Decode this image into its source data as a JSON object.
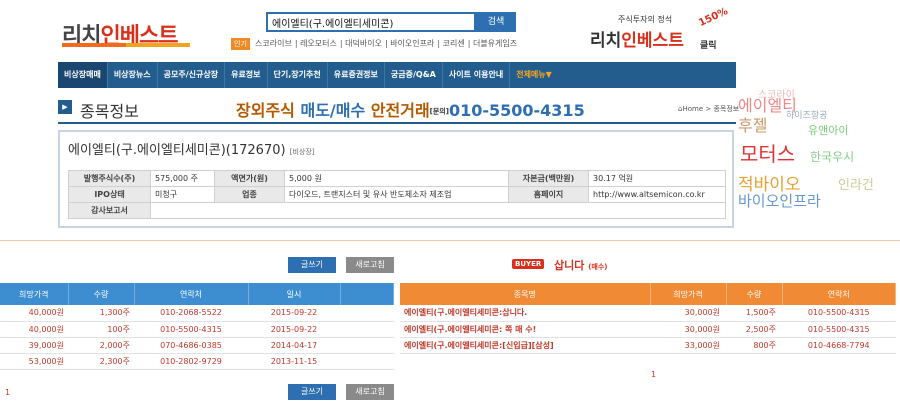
{
  "header": {
    "logo_a": "리치",
    "logo_b": "인베스트",
    "search_value": "에이엘티(구.에이엘티세미콘)",
    "search_button": "검색",
    "hot_badge": "인기",
    "hot_links": [
      "스코라이브",
      "레오모터스",
      "대덕바이오",
      "바이오인프라",
      "코리센",
      "더블유게임즈"
    ],
    "ad_line1": "주식투자의 정석",
    "ad_logo_a": "리치",
    "ad_logo_b": "인베스트",
    "ad_pct": "150%",
    "ad_click": "클릭"
  },
  "nav": {
    "items": [
      "비상장매매",
      "비상장뉴스",
      "공모주/신규상장",
      "유료정보",
      "단기,장기추천",
      "유료증권정보",
      "궁금증/Q&A",
      "사이트 이용안내"
    ],
    "all_menu": "전체메뉴▼"
  },
  "title_row": {
    "icon": "▶",
    "title": "종목정보",
    "banner_a": "장외주식",
    "banner_b": "매도/매수",
    "banner_c": "안전거래",
    "banner_small": "[문의]",
    "banner_phone": "010-5500-4315",
    "crumb": "Home > 종목정보"
  },
  "company": {
    "name": "에이엘티(구.에이엘티세미콘)(172670)",
    "tag": "[비상장]",
    "rows": [
      [
        "발행주식수(주)",
        "575,000 주",
        "액면가(원)",
        "5,000 원",
        "자본금(백만원)",
        "30.17 억원"
      ],
      [
        "IPO상태",
        "미청구",
        "업종",
        "다이오드, 트랜지스터 및 유사 반도체소자 제조업",
        "홈페이지",
        "http://www.altsemicon.co.kr"
      ],
      [
        "감사보고서",
        "",
        "",
        "",
        "",
        ""
      ]
    ]
  },
  "cloud": {
    "words": [
      "스코라이",
      "에이엘티",
      "하이즈항공",
      "후젤",
      "유앤아이",
      "모터스",
      "한국우시",
      "적바이오",
      "인라건",
      "바이오인프라"
    ]
  },
  "sell": {
    "write_button": "글쓰기",
    "refresh_button": "새로고침",
    "headers": [
      "희망가격",
      "수량",
      "연락처",
      "일시"
    ],
    "rows": [
      [
        "40,000원",
        "1,300주",
        "010-2068-5522",
        "2015-09-22"
      ],
      [
        "40,000원",
        "100주",
        "010-5500-4315",
        "2015-09-22"
      ],
      [
        "39,000원",
        "2,000주",
        "070-4686-0385",
        "2014-04-17"
      ],
      [
        "53,000원",
        "2,300주",
        "010-2802-9729",
        "2013-11-15"
      ]
    ],
    "page": "1"
  },
  "buy": {
    "badge": "BUYER",
    "title": "삽니다",
    "title_small": "(매수)",
    "headers": [
      "종목명",
      "희망가격",
      "수량",
      "연락처"
    ],
    "rows": [
      [
        "에이엘티(구.에이엘티세미콘:삽니다.",
        "30,000원",
        "1,500주",
        "010-5500-4315"
      ],
      [
        "에이엘티(구.에이엘티세미콘: 쪽 매 수!",
        "30,000원",
        "2,500주",
        "010-5500-4315"
      ],
      [
        "에이엘티(구.에이엘티세미콘:[신입급][삼성]",
        "33,000원",
        "800주",
        "010-4668-7794"
      ]
    ],
    "page": "1"
  }
}
